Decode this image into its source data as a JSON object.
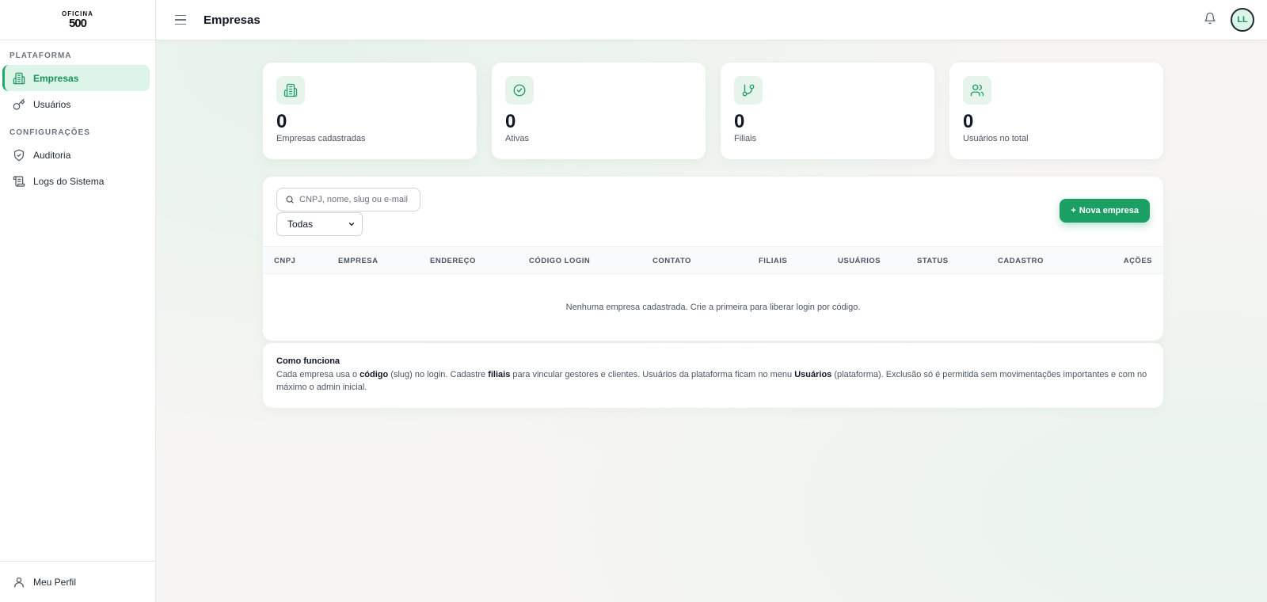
{
  "logo": {
    "top": "OFICINA",
    "num": "500"
  },
  "sidebar": {
    "section_platform": "PLATAFORMA",
    "items_platform": [
      {
        "label": "Empresas",
        "icon": "building-icon",
        "active": true
      },
      {
        "label": "Usuários",
        "icon": "key-icon",
        "active": false
      }
    ],
    "section_config": "CONFIGURAÇÕES",
    "items_config": [
      {
        "label": "Auditoria",
        "icon": "shield-check-icon"
      },
      {
        "label": "Logs do Sistema",
        "icon": "scroll-icon"
      }
    ],
    "footer_label": "Meu Perfil"
  },
  "header": {
    "title": "Empresas",
    "avatar_initials": "LL"
  },
  "stats": [
    {
      "value": "0",
      "label": "Empresas cadastradas",
      "icon": "building-icon"
    },
    {
      "value": "0",
      "label": "Ativas",
      "icon": "check-circle-icon"
    },
    {
      "value": "0",
      "label": "Filiais",
      "icon": "git-branch-icon"
    },
    {
      "value": "0",
      "label": "Usuários no total",
      "icon": "users-icon"
    }
  ],
  "toolbar": {
    "search_placeholder": "CNPJ, nome, slug ou e-mail",
    "filter_value": "Todas",
    "new_button": "Nova empresa",
    "new_button_prefix": "+"
  },
  "table": {
    "columns": [
      "CNPJ",
      "EMPRESA",
      "ENDEREÇO",
      "CÓDIGO LOGIN",
      "CONTATO",
      "FILIAIS",
      "USUÁRIOS",
      "STATUS",
      "CADASTRO",
      "AÇÕES"
    ],
    "empty_message": "Nenhuma empresa cadastrada. Crie a primeira para liberar login por código."
  },
  "info": {
    "title": "Como funciona",
    "t1": "Cada empresa usa o ",
    "b1": "código",
    "t2": " (slug) no login. Cadastre ",
    "b2": "filiais",
    "t3": " para vincular gestores e clientes. Usuários da plataforma ficam no menu ",
    "b3": "Usuários",
    "t4": " (plataforma). Exclusão só é permitida sem movimentações importantes e com no máximo o admin inicial."
  },
  "colors": {
    "accent": "#1c9f63",
    "accent_light": "#dcf5e8"
  }
}
